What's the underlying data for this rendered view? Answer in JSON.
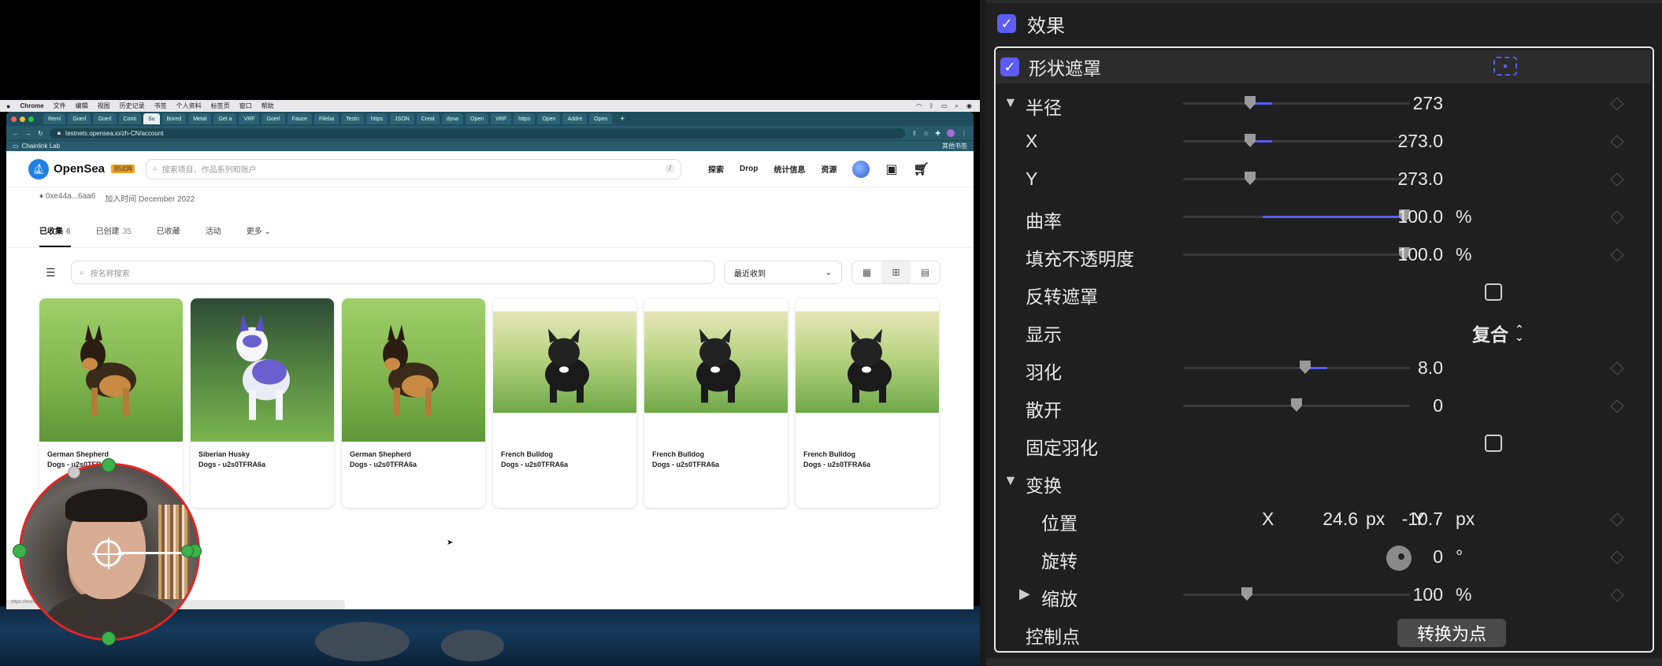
{
  "browser": {
    "menubar": {
      "app": "Chrome",
      "items": [
        "文件",
        "编辑",
        "视图",
        "历史记录",
        "书签",
        "个人资料",
        "标签页",
        "窗口",
        "帮助"
      ]
    },
    "tabs": [
      "Remi",
      "Goerl",
      "Goerl",
      "Conti",
      "Su",
      "Bored",
      "Metal",
      "Get a",
      "VRF",
      "Goerl",
      "Fauce",
      "Fileba",
      "Testn",
      "https",
      "JSON",
      "Creat",
      "dyna",
      "Open",
      "VRF",
      "https",
      "Open",
      "Addre",
      "Open"
    ],
    "active_tab_index": 4,
    "url": "testnets.opensea.io/zh-CN/account",
    "bookmark": "Chainlink Lab",
    "bookmark_right": "其他书签",
    "status_url": "https://testnets.opensea.io/assets/goerli/0x..."
  },
  "opensea": {
    "logo": "OpenSea",
    "badge": "测试网",
    "search_placeholder": "搜索项目、作品系列和账户",
    "search_shortcut": "/",
    "nav": [
      "探索",
      "Drop",
      "统计信息",
      "资源"
    ],
    "address": "0xe44a...6aa6",
    "joined": "加入时间 December 2022",
    "tabs": [
      {
        "label": "已收集",
        "count": "6",
        "active": true
      },
      {
        "label": "已创建",
        "count": "35",
        "active": false
      },
      {
        "label": "已收藏",
        "count": "",
        "active": false
      },
      {
        "label": "活动",
        "count": "",
        "active": false
      },
      {
        "label": "更多",
        "count": "",
        "active": false
      }
    ],
    "filter_placeholder": "按名称搜索",
    "sort": "最近收到",
    "cards": [
      {
        "name": "German Shepherd",
        "collection": "Dogs - u2s0TFRA6a",
        "breed": "shepherd"
      },
      {
        "name": "Siberian Husky",
        "collection": "Dogs - u2s0TFRA6a",
        "breed": "husky"
      },
      {
        "name": "German Shepherd",
        "collection": "Dogs - u2s0TFRA6a",
        "breed": "shepherd"
      },
      {
        "name": "French Bulldog",
        "collection": "Dogs - u2s0TFRA6a",
        "breed": "bulldog"
      },
      {
        "name": "French Bulldog",
        "collection": "Dogs - u2s0TFRA6a",
        "breed": "bulldog"
      },
      {
        "name": "French Bulldog",
        "collection": "Dogs - u2s0TFRA6a",
        "breed": "bulldog"
      }
    ]
  },
  "inspector": {
    "accent": "#5d5cf6",
    "effects_label": "效果",
    "shape_mask_label": "形状遮罩",
    "radius": {
      "label": "半径",
      "value": "273",
      "level": 0.285
    },
    "x": {
      "label": "X",
      "value": "273.0",
      "level": 0.285
    },
    "y": {
      "label": "Y",
      "value": "273.0",
      "level": 0.285
    },
    "curvature": {
      "label": "曲率",
      "value": "100.0",
      "unit": "%",
      "level": 1.0
    },
    "fill_opacity": {
      "label": "填充不透明度",
      "value": "100.0",
      "unit": "%",
      "level": 1.0
    },
    "invert_mask": {
      "label": "反转遮罩",
      "checked": false
    },
    "display": {
      "label": "显示",
      "value": "复合"
    },
    "feather": {
      "label": "羽化",
      "value": "8.0",
      "level": 0.54
    },
    "falloff": {
      "label": "散开",
      "value": "0",
      "level": 0.5
    },
    "fixed_feather": {
      "label": "固定羽化",
      "checked": false
    },
    "transform": {
      "label": "变换"
    },
    "position": {
      "label": "位置",
      "x_label": "X",
      "x_value": "24.6",
      "x_unit": "px",
      "y_label": "Y",
      "y_value": "-10.7",
      "y_unit": "px"
    },
    "rotation": {
      "label": "旋转",
      "value": "0",
      "unit": "°"
    },
    "scale": {
      "label": "缩放",
      "value": "100",
      "unit": "%",
      "level": 0.27
    },
    "control_points": {
      "label": "控制点",
      "button": "转换为点"
    }
  }
}
